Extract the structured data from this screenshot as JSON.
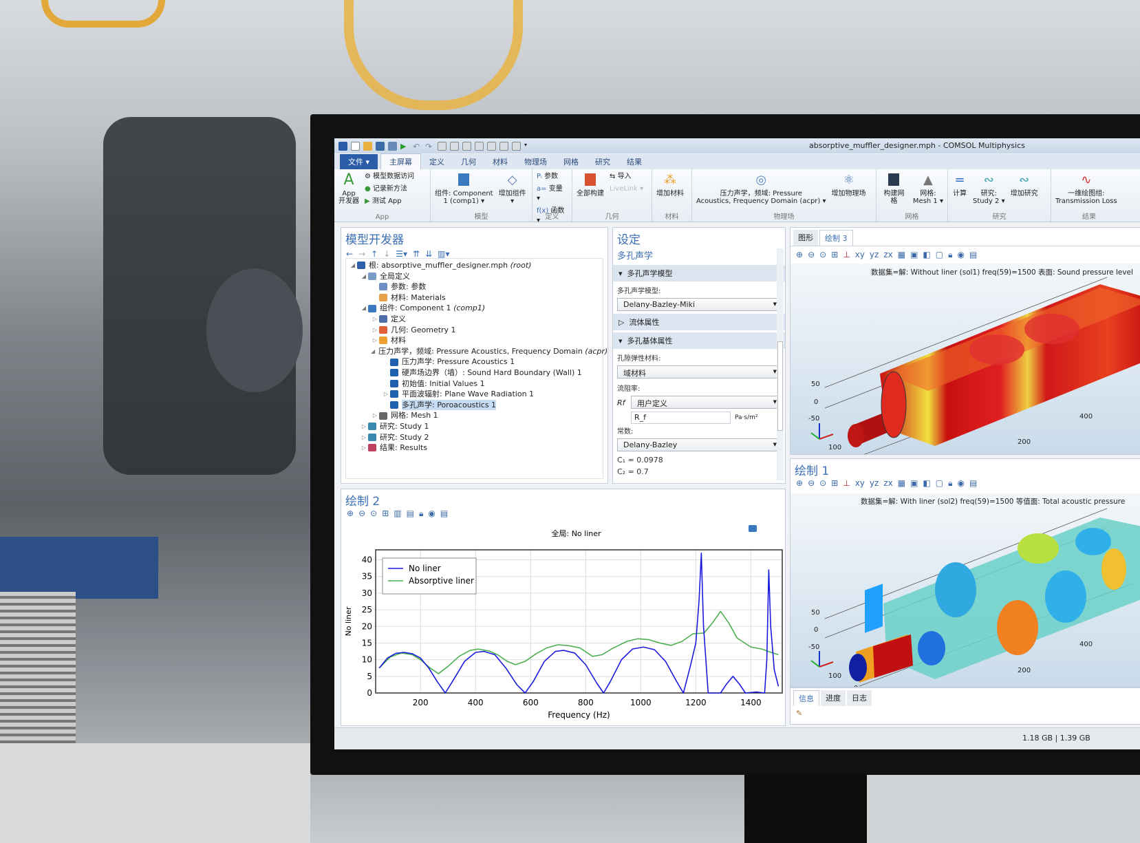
{
  "window": {
    "title": "absorptive_muffler_designer.mph - COMSOL Multiphysics"
  },
  "tabs": [
    {
      "label": "文件 ▾"
    },
    {
      "label": "主屏幕"
    },
    {
      "label": "定义"
    },
    {
      "label": "几何"
    },
    {
      "label": "材料"
    },
    {
      "label": "物理场"
    },
    {
      "label": "网格"
    },
    {
      "label": "研究"
    },
    {
      "label": "结果"
    }
  ],
  "ribbon": {
    "app": {
      "group": "App",
      "big": "App\n开发器",
      "items": [
        "模型数据访问",
        "记录新方法",
        "测试 App"
      ]
    },
    "model": {
      "group": "模型",
      "component": "组件: Component\n1 (comp1) ▾",
      "add_component": "增加组件\n▾"
    },
    "definitions": {
      "group": "定义",
      "items": [
        "参数",
        "变量 ▾",
        "函数 ▾"
      ]
    },
    "geometry": {
      "group": "几何",
      "build_all": "全部构建",
      "import": "导入",
      "livelink": "LiveLink ▾"
    },
    "materials": {
      "group": "材料",
      "add": "增加材料"
    },
    "physics": {
      "group": "物理场",
      "current": "压力声学，频域: Pressure\nAcoustics, Frequency Domain (acpr) ▾",
      "add": "增加物理场"
    },
    "mesh": {
      "group": "网格",
      "build": "构建网格",
      "mesh": "网格:\nMesh 1 ▾"
    },
    "study": {
      "group": "研究",
      "compute": "计算",
      "study": "研究:\nStudy 2 ▾",
      "add": "增加研究"
    },
    "results": {
      "group": "结果",
      "plot": "一维绘图组:\nTransmission Loss"
    }
  },
  "model_builder": {
    "title": "模型开发器",
    "tree": [
      {
        "label": "根: absorptive_muffler_designer.mph",
        "tag": "(root)",
        "level": 0,
        "exp": "◢",
        "color": "#2f5fa8"
      },
      {
        "label": "全局定义",
        "level": 1,
        "exp": "◢",
        "color": "#7a9cc8"
      },
      {
        "label": "参数: 参数",
        "level": 2,
        "exp": "",
        "color": "#6d8fc4"
      },
      {
        "label": "材料: Materials",
        "level": 2,
        "exp": "",
        "color": "#e8a04a"
      },
      {
        "label": "组件: Component 1",
        "tag": "(comp1)",
        "level": 1,
        "exp": "◢",
        "color": "#3a78c0"
      },
      {
        "label": "定义",
        "level": 2,
        "exp": "▷",
        "color": "#4c6fa8"
      },
      {
        "label": "几何: Geometry 1",
        "level": 2,
        "exp": "▷",
        "color": "#e0603a"
      },
      {
        "label": "材料",
        "level": 2,
        "exp": "▷",
        "color": "#f0a030"
      },
      {
        "label": "压力声学，频域: Pressure Acoustics, Frequency Domain",
        "tag": "(acpr)",
        "level": 2,
        "exp": "◢",
        "color": "#8fb0d8"
      },
      {
        "label": "压力声学: Pressure Acoustics 1",
        "level": 3,
        "exp": "",
        "color": "#2060b0"
      },
      {
        "label": "硬声场边界（墙）: Sound Hard Boundary (Wall) 1",
        "level": 3,
        "exp": "",
        "color": "#2060b0"
      },
      {
        "label": "初始值: Initial Values 1",
        "level": 3,
        "exp": "",
        "color": "#2060b0"
      },
      {
        "label": "平面波辐射: Plane Wave Radiation 1",
        "level": 3,
        "exp": "▷",
        "color": "#2060b0"
      },
      {
        "label": "多孔声学: Poroacoustics 1",
        "level": 3,
        "exp": "",
        "color": "#2060b0",
        "selected": true
      },
      {
        "label": "网格: Mesh 1",
        "level": 2,
        "exp": "▷",
        "color": "#666"
      },
      {
        "label": "研究: Study 1",
        "level": 1,
        "exp": "▷",
        "color": "#3a8ab0"
      },
      {
        "label": "研究: Study 2",
        "level": 1,
        "exp": "▷",
        "color": "#3a8ab0"
      },
      {
        "label": "结果: Results",
        "level": 1,
        "exp": "▷",
        "color": "#c04060"
      }
    ]
  },
  "settings": {
    "title": "设定",
    "subtitle": "多孔声学",
    "sec1": "多孔声学模型",
    "model_label": "多孔声学模型:",
    "model_value": "Delany-Bazley-Miki",
    "sec2": "流体属性",
    "sec3": "多孔基体属性",
    "poro_label": "孔隙弹性材料:",
    "poro_value": "域材料",
    "flow_label": "流阻率:",
    "rf_symbol": "Rf",
    "rf_mode": "用户定义",
    "rf_value": "R_f",
    "rf_unit": "Pa·s/m²",
    "const_label": "常数:",
    "const_value": "Delany-Bazley",
    "c1": "C₁ = 0.0978",
    "c2": "C₂ = 0.7"
  },
  "graphics_top": {
    "tabs": [
      "图形",
      "绘制 3"
    ],
    "caption": "数据集=解: Without liner (sol1) freq(59)=1500   表面: Sound pressure level",
    "axis": [
      "50",
      "0",
      "-50",
      "100",
      "200",
      "400"
    ]
  },
  "plot1": {
    "title": "绘制 1",
    "caption": "数据集=解: With liner (sol2) freq(59)=1500   等值面: Total acoustic pressure",
    "axis": [
      "50",
      "0",
      "-50",
      "100",
      "200",
      "400",
      "0"
    ]
  },
  "plot2": {
    "title": "绘制 2"
  },
  "info": {
    "tabs": [
      "信息",
      "进度",
      "日志"
    ]
  },
  "status": {
    "memory": "1.18 GB | 1.39 GB"
  },
  "chart_data": {
    "type": "line",
    "title": "全局: No liner",
    "xlabel": "Frequency (Hz)",
    "ylabel": "No liner",
    "xlim": [
      37,
      1514
    ],
    "ylim": [
      0,
      43
    ],
    "xticks": [
      200,
      400,
      600,
      800,
      1000,
      1200,
      1400
    ],
    "yticks": [
      0,
      5,
      10,
      15,
      20,
      25,
      30,
      35,
      40
    ],
    "grid": true,
    "legend": "top-left",
    "series": [
      {
        "name": "No liner",
        "color": "#1a1adc",
        "x": [
          50,
          80,
          110,
          140,
          170,
          200,
          230,
          260,
          290,
          320,
          360,
          400,
          430,
          470,
          510,
          550,
          580,
          610,
          650,
          690,
          720,
          760,
          800,
          840,
          865,
          890,
          930,
          970,
          1010,
          1050,
          1090,
          1130,
          1155,
          1180,
          1200,
          1212,
          1220,
          1228,
          1245,
          1290,
          1310,
          1335,
          1360,
          1380,
          1420,
          1450,
          1458,
          1465,
          1472,
          1485,
          1500
        ],
        "y": [
          7.5,
          10.5,
          11.9,
          12.2,
          11.8,
          10.5,
          7.5,
          3.5,
          0,
          4,
          9.5,
          12.2,
          12.5,
          11.5,
          7.5,
          2.5,
          0,
          3.5,
          9.5,
          12.5,
          12.8,
          12,
          8.5,
          3,
          0,
          3.5,
          10,
          13.2,
          13.8,
          13,
          9.5,
          3.5,
          0,
          8,
          15,
          28,
          42,
          20,
          0,
          0,
          2.5,
          5,
          2.5,
          0,
          0.3,
          0,
          10,
          37,
          20,
          7,
          2
        ]
      },
      {
        "name": "Absorptive liner",
        "color": "#4caf50",
        "x": [
          50,
          90,
          130,
          170,
          200,
          235,
          265,
          300,
          340,
          380,
          410,
          450,
          480,
          515,
          545,
          580,
          620,
          660,
          700,
          740,
          780,
          825,
          860,
          900,
          950,
          990,
          1030,
          1070,
          1110,
          1150,
          1190,
          1230,
          1260,
          1290,
          1320,
          1350,
          1400,
          1440,
          1470,
          1500
        ],
        "y": [
          7.5,
          10.8,
          12,
          11.5,
          10,
          7.5,
          5.8,
          8,
          11,
          12.8,
          13.2,
          12.6,
          11.5,
          9.5,
          8.5,
          9.5,
          11.8,
          13.6,
          14.5,
          14.2,
          13.5,
          11,
          11.5,
          13.5,
          15.5,
          16.3,
          16,
          15,
          14.3,
          15.5,
          17.8,
          18,
          21,
          24.5,
          21,
          16.5,
          13.8,
          13.2,
          12.3,
          11.5
        ]
      }
    ]
  }
}
